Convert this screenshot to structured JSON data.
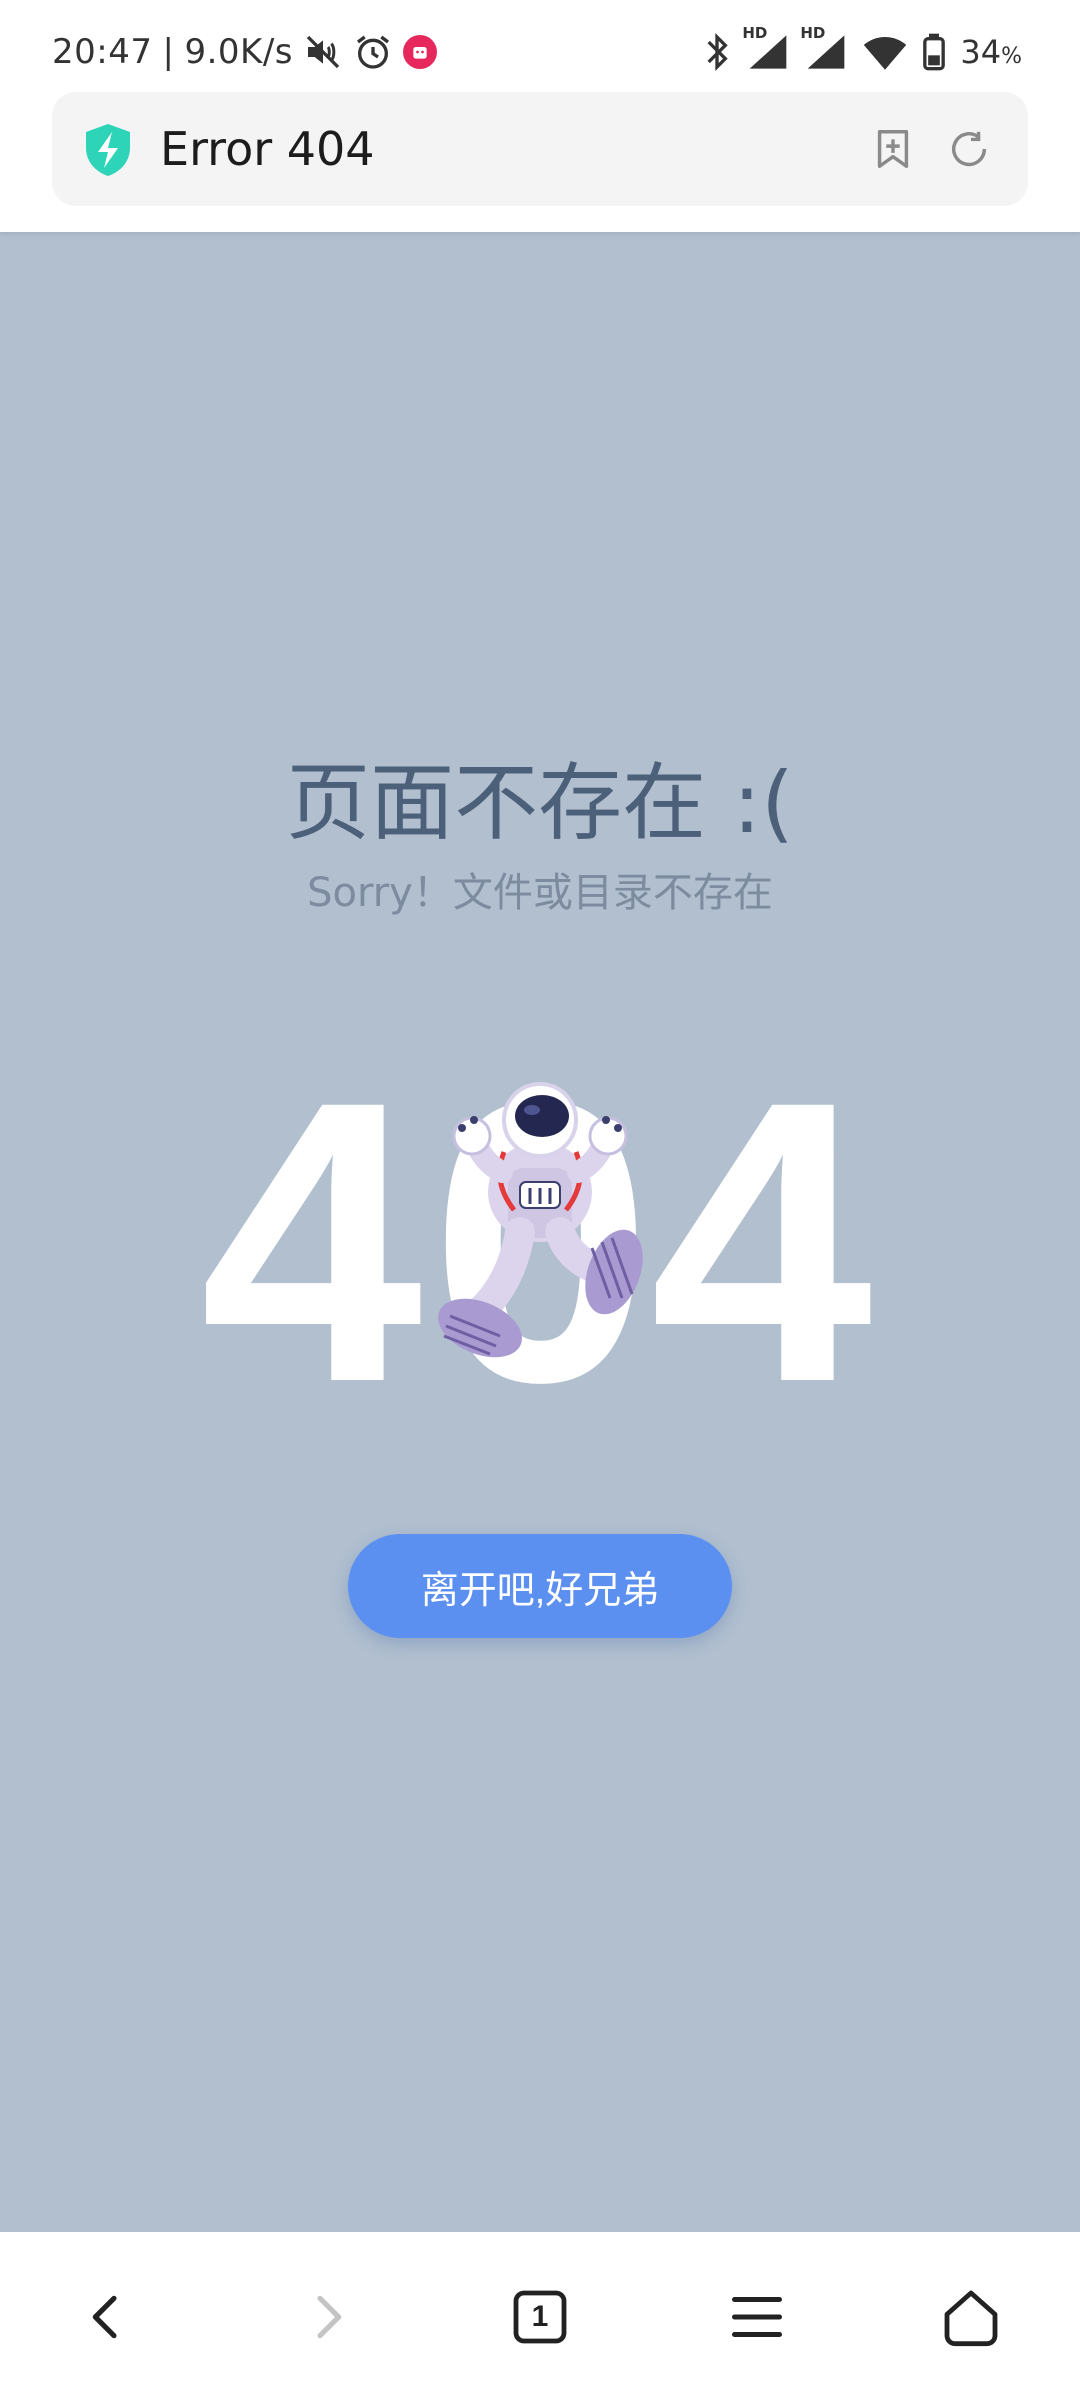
{
  "status_bar": {
    "time": "20:47",
    "separator": "|",
    "network_speed": "9.0K/s",
    "battery_percent": "34",
    "battery_unit": "%",
    "hd_badge_1": "HD",
    "hd_badge_2": "HD",
    "icons": [
      "mute-icon",
      "alarm-icon",
      "app-notification-icon",
      "bluetooth-icon",
      "signal-icon",
      "signal-icon",
      "wifi-icon",
      "battery-icon"
    ]
  },
  "browser": {
    "page_title": "Error 404",
    "icons": [
      "shield-icon",
      "bookmark-add-icon",
      "reload-icon"
    ],
    "shield_color": "#2dd4b8"
  },
  "page": {
    "title": "页面不存在 :(",
    "subtitle": "Sorry！文件或目录不存在",
    "code_digits": [
      "4",
      "0",
      "4"
    ],
    "button_label": "离开吧,好兄弟",
    "background_color": "#b1bfcf",
    "button_color": "#5b8ff0",
    "illustration": "astronaut"
  },
  "bottom_nav": {
    "tab_count": "1",
    "items": [
      "back-icon",
      "forward-icon",
      "tabs-icon",
      "menu-icon",
      "home-icon"
    ]
  }
}
